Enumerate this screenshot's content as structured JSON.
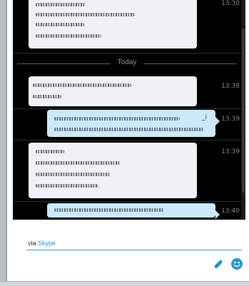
{
  "conversation": {
    "day_divider": "Today",
    "messages": [
      {
        "direction": "incoming",
        "time": "13:30"
      },
      {
        "direction": "incoming",
        "time": "13:38"
      },
      {
        "direction": "outgoing",
        "time": "13:39",
        "edited_mark": "_i"
      },
      {
        "direction": "incoming",
        "time": "13:39"
      },
      {
        "direction": "outgoing",
        "time": "13:40"
      }
    ]
  },
  "compose": {
    "via_prefix": "via",
    "via_service": "Skype"
  },
  "icons": {
    "attach": "paperclip-icon",
    "emoji": "emoji-icon"
  },
  "colors": {
    "accent": "#2a93c8",
    "incoming_bubble": "#eef2f6",
    "outgoing_bubble": "#cbe9f8",
    "chat_background": "#000000"
  }
}
